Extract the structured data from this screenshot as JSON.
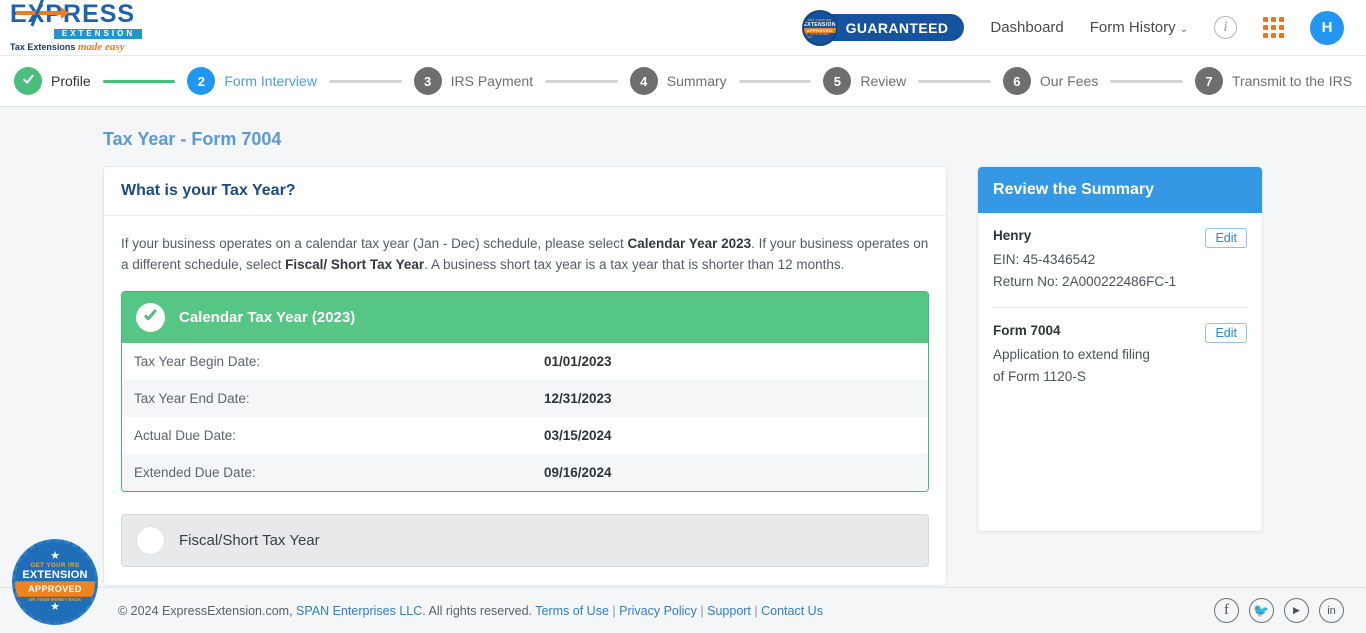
{
  "header": {
    "logo": {
      "main": "EXPRESS",
      "sub": "EXTENSION",
      "tagline_plain": "Tax Extensions ",
      "tagline_italic": "made easy"
    },
    "guaranteed_label": "GUARANTEED",
    "seal": {
      "line1": "GET YOUR IRS",
      "line2": "EXTENSION",
      "line3": "APPROVED",
      "line4": "OR YOUR MONEY BACK"
    },
    "dashboard_label": "Dashboard",
    "form_history_label": "Form History",
    "chevron": "⌄",
    "info_icon_label": "i",
    "avatar_initial": "H"
  },
  "stepper": {
    "steps": [
      {
        "num": "1",
        "label": "Profile",
        "state": "done"
      },
      {
        "num": "2",
        "label": "Form Interview",
        "state": "active"
      },
      {
        "num": "3",
        "label": "IRS Payment",
        "state": "todo"
      },
      {
        "num": "4",
        "label": "Summary",
        "state": "todo"
      },
      {
        "num": "5",
        "label": "Review",
        "state": "todo"
      },
      {
        "num": "6",
        "label": "Our Fees",
        "state": "todo"
      },
      {
        "num": "7",
        "label": "Transmit to the IRS",
        "state": "todo"
      }
    ]
  },
  "main": {
    "page_title": "Tax Year - Form 7004",
    "card_heading": "What is your Tax Year?",
    "description": {
      "part1": "If your business operates on a calendar tax year (Jan - Dec) schedule, please select ",
      "bold1": "Calendar Year 2023",
      "part2": ". If your business operates on a different schedule, select ",
      "bold2": "Fiscal/ Short Tax Year",
      "part3": ". A business short tax year is a tax year that is shorter than 12 months."
    },
    "selected_option": {
      "title": "Calendar Tax Year (2023)",
      "rows": [
        {
          "label": "Tax Year Begin Date:",
          "value": "01/01/2023"
        },
        {
          "label": "Tax Year End Date:",
          "value": "12/31/2023"
        },
        {
          "label": "Actual Due Date:",
          "value": "03/15/2024"
        },
        {
          "label": "Extended Due Date:",
          "value": "09/16/2024"
        }
      ]
    },
    "unselected_option": {
      "title": "Fiscal/Short Tax Year"
    }
  },
  "summary": {
    "heading": "Review the Summary",
    "blocks": [
      {
        "title": "Henry",
        "lines": [
          "EIN: 45-4346542",
          "Return No: 2A000222486FC-1"
        ],
        "edit_label": "Edit"
      },
      {
        "title": "Form 7004",
        "lines": [
          "Application to extend filing",
          "of Form 1120-S"
        ],
        "edit_label": "Edit"
      }
    ]
  },
  "footer": {
    "copyright": "© 2024 ExpressExtension.com, ",
    "company_link": "SPAN Enterprises LLC",
    "rights": ". All rights reserved. ",
    "links": [
      "Terms of Use",
      "Privacy Policy",
      "Support",
      "Contact Us"
    ],
    "separator": " | ",
    "socials": [
      {
        "name": "facebook",
        "glyph": "f"
      },
      {
        "name": "twitter",
        "glyph": "🐦"
      },
      {
        "name": "youtube",
        "glyph": "▶"
      },
      {
        "name": "linkedin",
        "glyph": "in"
      }
    ]
  },
  "colors": {
    "accent_blue": "#2196f3",
    "green": "#56c684",
    "orange": "#f2711c",
    "title_blue": "#5b9bd5"
  }
}
